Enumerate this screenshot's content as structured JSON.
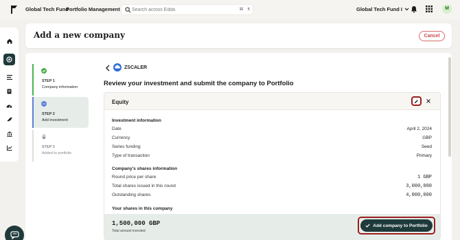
{
  "topbar": {
    "brand": "Global Tech Fund",
    "crumb": "Portfolio Management",
    "search_placeholder": "Search across Edda",
    "shortcut_cmd": "⌘",
    "shortcut_key": "K",
    "fund_selector": "Global Tech Fund I",
    "avatar_initial": "M"
  },
  "header": {
    "title": "Add a new company",
    "cancel_label": "Cancel"
  },
  "stepper": [
    {
      "label": "STEP 1",
      "title": "Company information",
      "state": "complete"
    },
    {
      "label": "STEP 2",
      "title": "Add investment",
      "state": "current"
    },
    {
      "label": "STEP 3",
      "title": "Added to portfolio",
      "state": "locked"
    }
  ],
  "company": {
    "name": "ZSCALER"
  },
  "review": {
    "title": "Review your investment and submit the company to Portfolio",
    "card_title": "Equity",
    "investment_section": "Investment information",
    "investment_rows": [
      {
        "label": "Date",
        "value": "April 2, 2024"
      },
      {
        "label": "Currency",
        "value": "GBP"
      },
      {
        "label": "Series funding",
        "value": "Seed"
      },
      {
        "label": "Type of transaction",
        "value": "Primary"
      }
    ],
    "shares_section": "Company's shares information",
    "shares_rows": [
      {
        "label": "Round price per share",
        "value": "1 GBP"
      },
      {
        "label": "Total shares issued in this round",
        "value": "3,000,000"
      },
      {
        "label": "Outstanding shares",
        "value": "4,000,000"
      }
    ],
    "your_shares_section": "Your shares in this company",
    "total_amount": "1,500,000 GBP",
    "total_caption": "Total amount invested",
    "submit_label": "Add company to Portfolio"
  },
  "colors": {
    "accent_dark": "#1f3a3a",
    "success": "#4caf50",
    "current_step": "#5b7fd6",
    "highlight_ring": "#9c1d1d",
    "cancel": "#c94848"
  }
}
